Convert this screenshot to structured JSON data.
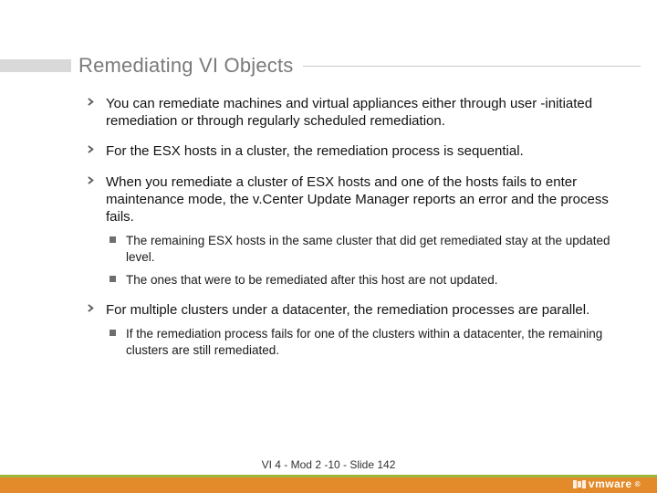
{
  "title": "Remediating VI Objects",
  "bullets": [
    {
      "text": "You can remediate machines and virtual appliances either through user -initiated remediation or through regularly scheduled remediation."
    },
    {
      "text": "For the ESX hosts in a cluster, the remediation process is sequential."
    },
    {
      "text": "When you remediate a cluster of ESX hosts and one of the hosts fails to enter maintenance mode, the v.Center Update Manager reports an error and the process fails.",
      "sub": [
        "The remaining ESX hosts in the same cluster that did get remediated stay at the updated level.",
        "The ones that were to be remediated after this host are not updated."
      ]
    },
    {
      "text": "For multiple clusters under a datacenter, the remediation processes are parallel.",
      "sub": [
        "If the remediation process fails for one of the clusters within a datacenter, the remaining clusters are still remediated."
      ]
    }
  ],
  "footer": "VI 4 - Mod 2 -10 - Slide 142",
  "logo": "vmware"
}
